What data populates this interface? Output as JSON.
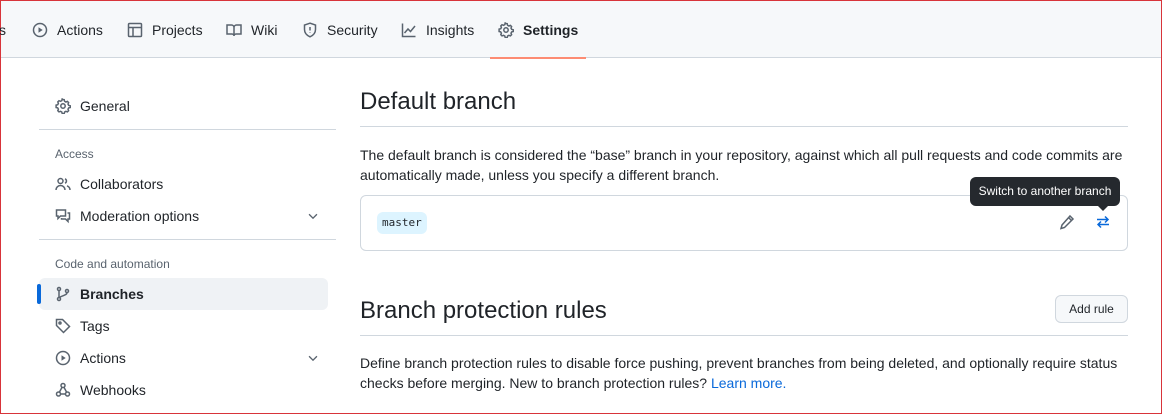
{
  "nav": {
    "partial_label": "s",
    "tabs": [
      {
        "label": "Actions",
        "icon": "play-circle-icon"
      },
      {
        "label": "Projects",
        "icon": "table-icon"
      },
      {
        "label": "Wiki",
        "icon": "book-icon"
      },
      {
        "label": "Security",
        "icon": "shield-icon"
      },
      {
        "label": "Insights",
        "icon": "graph-icon"
      },
      {
        "label": "Settings",
        "icon": "gear-icon",
        "active": true
      }
    ],
    "active_underline_color": "#fd8c73"
  },
  "sidebar": {
    "general": "General",
    "access_heading": "Access",
    "collaborators": "Collaborators",
    "moderation": "Moderation options",
    "code_heading": "Code and automation",
    "branches": "Branches",
    "tags": "Tags",
    "actions": "Actions",
    "webhooks": "Webhooks",
    "active_color": "#0969da"
  },
  "main": {
    "default_branch_title": "Default branch",
    "default_branch_desc_1": "The default branch is considered the “base” branch in your repository, against which all pull requests and code commits are",
    "default_branch_desc_2": "automatically made, unless you specify a different branch.",
    "branch_name": "master",
    "tooltip": "Switch to another branch",
    "protection_title": "Branch protection rules",
    "add_rule": "Add rule",
    "protection_desc_1": "Define branch protection rules to disable force pushing, prevent branches from being deleted, and optionally require status",
    "protection_desc_2": "checks before merging. New to branch protection rules?",
    "learn_more": "Learn more."
  }
}
